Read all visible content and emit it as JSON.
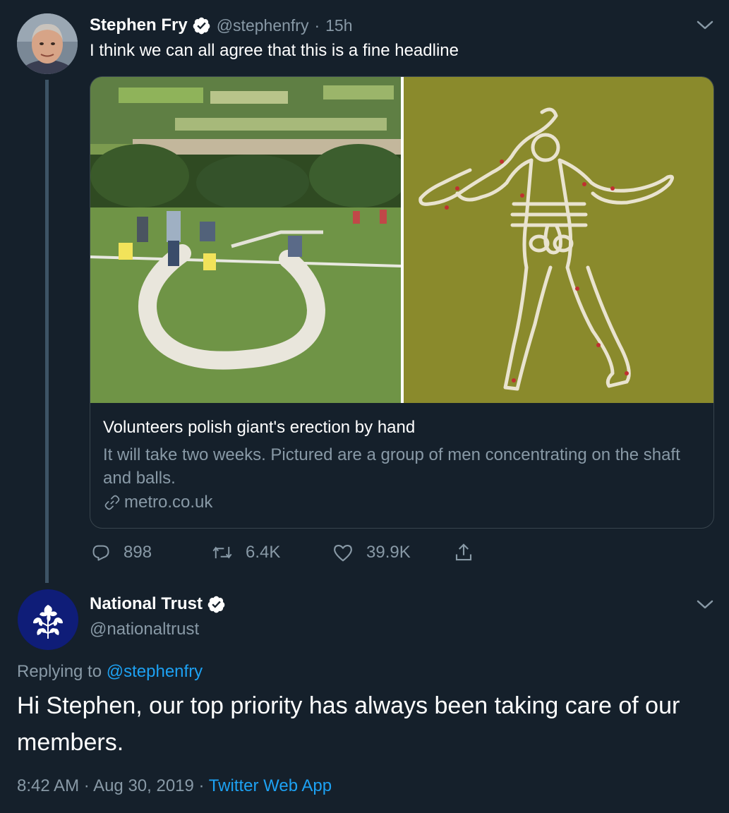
{
  "tweet": {
    "author": {
      "name": "Stephen Fry",
      "handle": "@stephenfry",
      "time": "15h"
    },
    "text": "I think we can all agree that this is a fine headline",
    "card": {
      "title": "Volunteers polish giant's erection by hand",
      "description": "It will take two weeks. Pictured are a group of men concentrating on the shaft and balls.",
      "domain": "metro.co.uk"
    },
    "actions": {
      "replies": "898",
      "retweets": "6.4K",
      "likes": "39.9K"
    },
    "icons": [
      "verified-badge-icon",
      "chevron-down-icon",
      "link-icon",
      "reply-icon",
      "retweet-icon",
      "like-icon",
      "share-icon"
    ]
  },
  "reply": {
    "author": {
      "name": "National Trust",
      "handle": "@nationaltrust"
    },
    "replying_prefix": "Replying to",
    "replying_to": "@stephenfry",
    "text": "Hi Stephen, our top priority has always been taking care of our members.",
    "time": "8:42 AM",
    "date": "Aug 30, 2019",
    "source": "Twitter Web App",
    "icons": [
      "oak-leaf-logo-icon",
      "verified-badge-icon",
      "chevron-down-icon"
    ]
  },
  "colors": {
    "background": "#15202b",
    "text": "#ffffff",
    "secondary": "#8899a6",
    "link": "#1da1f2",
    "border": "#38444d"
  }
}
